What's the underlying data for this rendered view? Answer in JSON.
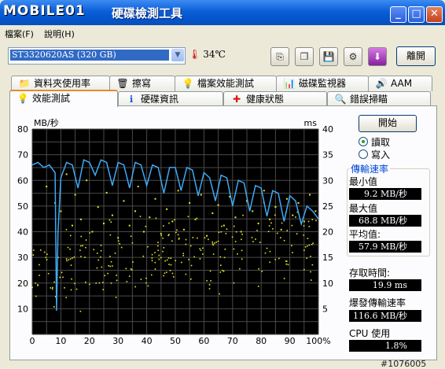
{
  "window": {
    "logo_text": "MOBILE01",
    "title": "硬碟檢測工具",
    "controls": [
      "_",
      "□",
      "✕"
    ]
  },
  "menu": [
    "檔案(F)",
    "說明(H)"
  ],
  "toolbar": {
    "drive": "ST3320620AS (320 GB)",
    "temperature": "34℃",
    "icons": [
      "copy-icon",
      "copy-screenshot-icon",
      "save-icon",
      "options-icon",
      "download-icon"
    ],
    "exit_label": "離開"
  },
  "tabs_top": [
    {
      "label": "資料夾使用率",
      "icon": "folder-icon"
    },
    {
      "label": "擦寫",
      "icon": "trash-icon"
    },
    {
      "label": "檔案效能測試",
      "icon": "bulb-icon"
    },
    {
      "label": "磁碟監視器",
      "icon": "monitor-icon"
    },
    {
      "label": "AAM",
      "icon": "speaker-icon"
    }
  ],
  "tabs_bottom": [
    {
      "label": "效能測試",
      "icon": "bulb-icon",
      "active": true
    },
    {
      "label": "硬碟資訊",
      "icon": "info-icon"
    },
    {
      "label": "健康狀態",
      "icon": "health-cross-icon"
    },
    {
      "label": "錯誤掃瞄",
      "icon": "magnifier-icon"
    }
  ],
  "chart_data": {
    "type": "line",
    "ylabel": "MB/秒",
    "y2label": "ms",
    "ylim": [
      0,
      80
    ],
    "y2lim": [
      0,
      40
    ],
    "xlim": [
      0,
      100
    ],
    "x_ticks": [
      "0",
      "10",
      "20",
      "30",
      "40",
      "50",
      "60",
      "70",
      "80",
      "90",
      "100%"
    ],
    "y_ticks": [
      "10",
      "20",
      "30",
      "40",
      "50",
      "60",
      "70",
      "80"
    ],
    "y2_ticks": [
      "5",
      "10",
      "15",
      "20",
      "25",
      "30",
      "35",
      "40"
    ],
    "grid": true,
    "colors": {
      "background": "#000000",
      "grid": "#4a4a4a",
      "transfer": "#3fa9f5",
      "access": "#e8e825"
    },
    "series": [
      {
        "type": "line",
        "x": [
          0,
          2,
          4,
          6,
          8,
          8.5,
          9,
          10,
          12,
          14,
          16,
          18,
          20,
          22,
          24,
          26,
          28,
          30,
          32,
          34,
          36,
          38,
          40,
          42,
          44,
          46,
          48,
          50,
          52,
          54,
          56,
          58,
          60,
          62,
          64,
          66,
          68,
          70,
          72,
          74,
          76,
          78,
          80,
          82,
          84,
          86,
          88,
          90,
          92,
          94,
          96,
          98,
          100
        ],
        "values": [
          66,
          67,
          65,
          66,
          63,
          9.2,
          40,
          61,
          67,
          66,
          57,
          68,
          67,
          62,
          68,
          67,
          58,
          67,
          66,
          57,
          67,
          66,
          58,
          66,
          65,
          55,
          65,
          65,
          56,
          65,
          64,
          54,
          63,
          61,
          52,
          62,
          61,
          50,
          60,
          59,
          48,
          58,
          57,
          46,
          56,
          55,
          44,
          54,
          52,
          43,
          50,
          48,
          45
        ]
      }
    ],
    "access_points": [
      [
        5,
        52
      ],
      [
        8,
        44
      ],
      [
        10,
        40
      ],
      [
        12,
        58
      ],
      [
        14,
        33
      ],
      [
        15,
        48
      ],
      [
        17,
        36
      ],
      [
        19,
        55
      ],
      [
        21,
        30
      ],
      [
        23,
        42
      ],
      [
        25,
        34
      ],
      [
        26,
        49
      ],
      [
        28,
        38
      ],
      [
        30,
        27
      ],
      [
        32,
        45
      ],
      [
        34,
        33
      ],
      [
        36,
        40
      ],
      [
        37,
        52
      ],
      [
        39,
        30
      ],
      [
        41,
        37
      ],
      [
        43,
        46
      ],
      [
        45,
        29
      ],
      [
        47,
        41
      ],
      [
        49,
        35
      ],
      [
        51,
        50
      ],
      [
        53,
        31
      ],
      [
        55,
        44
      ],
      [
        57,
        36
      ],
      [
        59,
        48
      ],
      [
        61,
        28
      ],
      [
        63,
        39
      ],
      [
        65,
        43
      ],
      [
        67,
        33
      ],
      [
        69,
        47
      ],
      [
        71,
        37
      ],
      [
        73,
        30
      ],
      [
        75,
        45
      ],
      [
        77,
        40
      ],
      [
        79,
        34
      ],
      [
        81,
        50
      ],
      [
        83,
        36
      ],
      [
        85,
        42
      ],
      [
        87,
        31
      ],
      [
        89,
        46
      ],
      [
        91,
        38
      ],
      [
        93,
        44
      ],
      [
        95,
        35
      ],
      [
        97,
        48
      ],
      [
        99,
        40
      ]
    ]
  },
  "controls": {
    "start_label": "開始",
    "read_label": "讀取",
    "write_label": "寫入"
  },
  "stats": {
    "group_title": "傳輸速率",
    "min_label": "最小值",
    "min_value": "9.2 MB/秒",
    "max_label": "最大值",
    "max_value": "68.8 MB/秒",
    "avg_label": "平均值:",
    "avg_value": "57.9 MB/秒",
    "access_label": "存取時間:",
    "access_value": "19.9 ms",
    "burst_label": "爆發傳輸速率",
    "burst_value": "116.6 MB/秒",
    "cpu_label": "CPU 使用",
    "cpu_value": "1.8%"
  },
  "watermark": "#1076005"
}
